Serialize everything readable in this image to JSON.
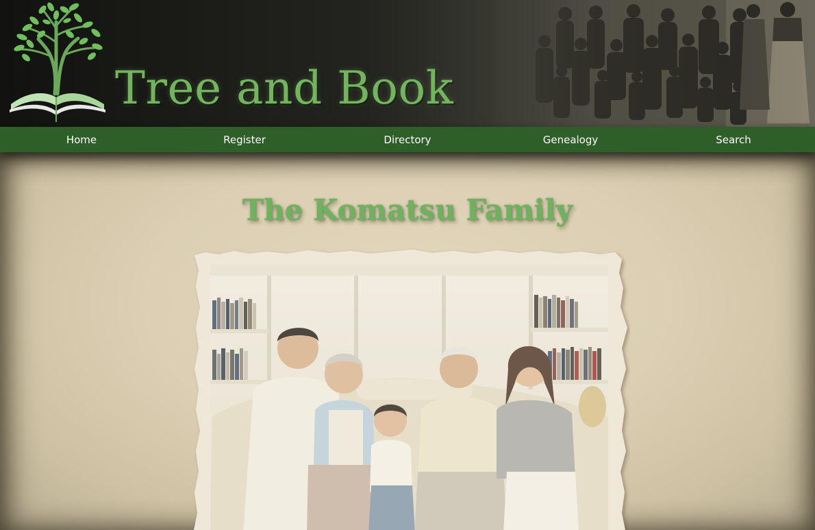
{
  "site": {
    "title": "Tree and Book"
  },
  "nav": {
    "items": [
      {
        "label": "Home"
      },
      {
        "label": "Register"
      },
      {
        "label": "Directory"
      },
      {
        "label": "Genealogy"
      },
      {
        "label": "Search"
      }
    ]
  },
  "page": {
    "family_title": "The Komatsu Family"
  },
  "colors": {
    "brand_green": "#72b55d",
    "nav_green": "#2f5f29",
    "parchment": "#d9cdb3"
  },
  "icons": {
    "logo": "tree-and-book-logo-icon"
  }
}
